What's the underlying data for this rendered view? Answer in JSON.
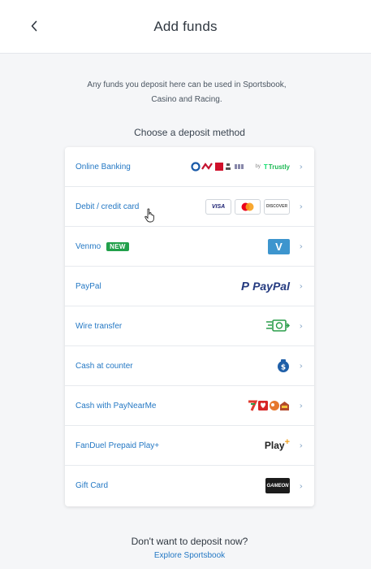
{
  "header": {
    "title": "Add funds"
  },
  "intro": {
    "line1": "Any funds you deposit here can be used in Sportsbook,",
    "line2": "Casino and Racing."
  },
  "choose_label": "Choose a deposit method",
  "methods": [
    {
      "label": "Online Banking",
      "logo_text": "by",
      "logo_brand": "Trustly"
    },
    {
      "label": "Debit / credit card",
      "logos": [
        "VISA",
        "DISCOVER"
      ]
    },
    {
      "label": "Venmo",
      "badge": "NEW",
      "logo": "V"
    },
    {
      "label": "PayPal",
      "logo": "PayPal"
    },
    {
      "label": "Wire transfer"
    },
    {
      "label": "Cash at counter"
    },
    {
      "label": "Cash with PayNearMe"
    },
    {
      "label": "FanDuel Prepaid Play+",
      "logo": "Play"
    },
    {
      "label": "Gift Card",
      "logo": "GAMEON"
    }
  ],
  "footer": {
    "question": "Don't want to deposit now?",
    "link": "Explore Sportsbook"
  },
  "colors": {
    "accent": "#2478c4",
    "new_badge": "#22a04b",
    "venmo": "#3d95ce",
    "paypal_dark": "#253b80",
    "paypal_light": "#179bd7"
  }
}
